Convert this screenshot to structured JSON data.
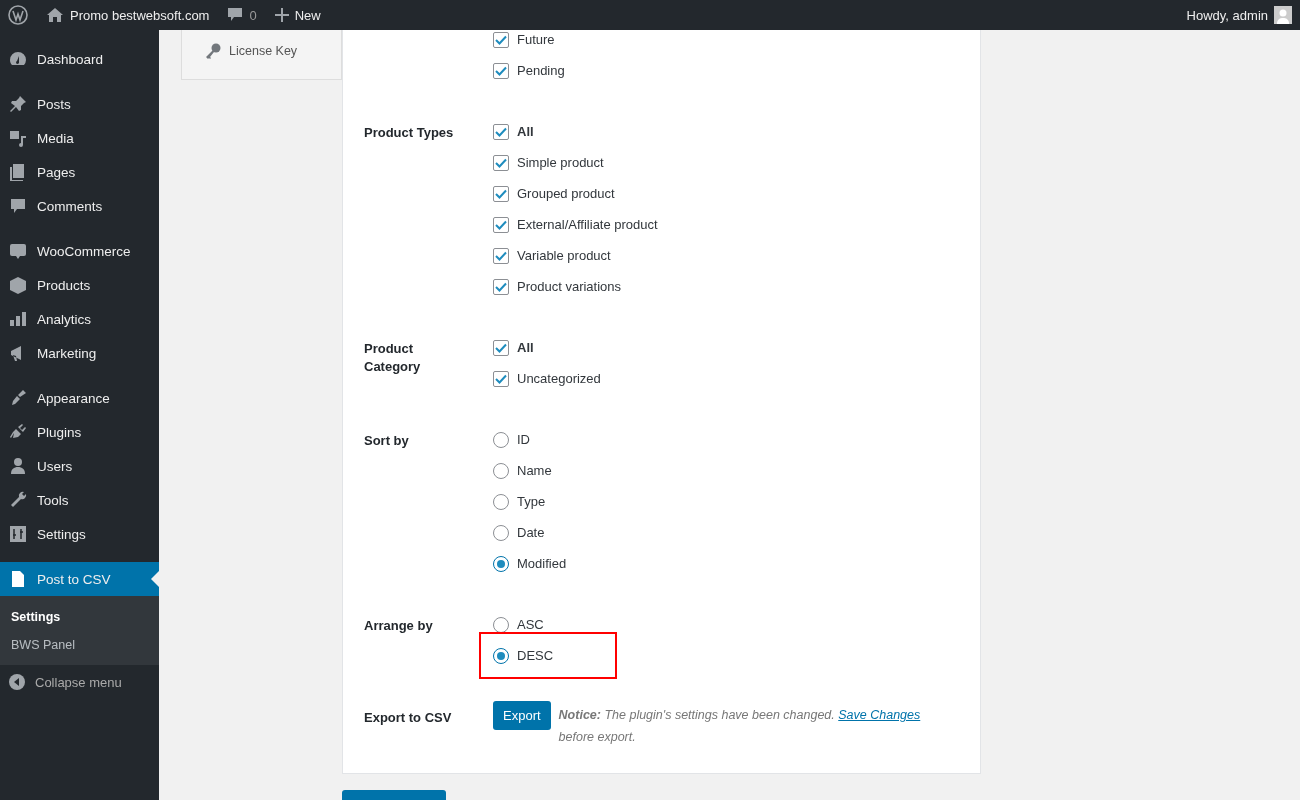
{
  "admin_bar": {
    "site": "Promo bestwebsoft.com",
    "comments": "0",
    "new": "New",
    "greeting": "Howdy, admin"
  },
  "sidebar": {
    "groups": [
      [
        {
          "label": "Dashboard",
          "selected": false
        }
      ],
      [
        {
          "label": "Posts",
          "selected": false
        },
        {
          "label": "Media",
          "selected": false
        },
        {
          "label": "Pages",
          "selected": false
        },
        {
          "label": "Comments",
          "selected": false
        }
      ],
      [
        {
          "label": "WooCommerce",
          "selected": false
        },
        {
          "label": "Products",
          "selected": false
        },
        {
          "label": "Analytics",
          "selected": false
        },
        {
          "label": "Marketing",
          "selected": false
        }
      ],
      [
        {
          "label": "Appearance",
          "selected": false
        },
        {
          "label": "Plugins",
          "selected": false
        },
        {
          "label": "Users",
          "selected": false
        },
        {
          "label": "Tools",
          "selected": false
        },
        {
          "label": "Settings",
          "selected": false
        }
      ],
      [
        {
          "label": "Post to CSV",
          "selected": true,
          "children": [
            {
              "label": "Settings",
              "selected": true
            },
            {
              "label": "BWS Panel",
              "selected": false
            }
          ]
        }
      ]
    ],
    "collapse": "Collapse menu"
  },
  "tabs": [
    {
      "label": "License Key",
      "selected": false
    }
  ],
  "sections": [
    {
      "kind": "checkbox",
      "options": [
        {
          "label": "Future",
          "checked": true
        },
        {
          "label": "Pending",
          "checked": true
        }
      ]
    },
    {
      "label": "Product Types",
      "kind": "checkbox",
      "options": [
        {
          "label": "All",
          "checked": true,
          "bold": true
        },
        {
          "label": "Simple product",
          "checked": true
        },
        {
          "label": "Grouped product",
          "checked": true
        },
        {
          "label": "External/Affiliate product",
          "checked": true
        },
        {
          "label": "Variable product",
          "checked": true
        },
        {
          "label": "Product variations",
          "checked": true
        }
      ]
    },
    {
      "label": "Product Category",
      "kind": "checkbox",
      "options": [
        {
          "label": "All",
          "checked": true,
          "bold": true
        },
        {
          "label": "Uncategorized",
          "checked": true
        }
      ]
    },
    {
      "label": "Sort by",
      "kind": "radio",
      "options": [
        {
          "label": "ID",
          "selected": false
        },
        {
          "label": "Name",
          "selected": false
        },
        {
          "label": "Type",
          "selected": false
        },
        {
          "label": "Date",
          "selected": false
        },
        {
          "label": "Modified",
          "selected": true
        }
      ]
    },
    {
      "label": "Arrange by",
      "kind": "radio",
      "options": [
        {
          "label": "ASC",
          "selected": false,
          "highlighted": false
        },
        {
          "label": "DESC",
          "selected": true,
          "highlighted": true
        }
      ]
    },
    {
      "label": "Export to CSV",
      "kind": "export",
      "button": "Export",
      "notice": "**Notice:** The plugin's settings have been changed.",
      "link": "Save Changes",
      "notice_end": "before export."
    }
  ]
}
